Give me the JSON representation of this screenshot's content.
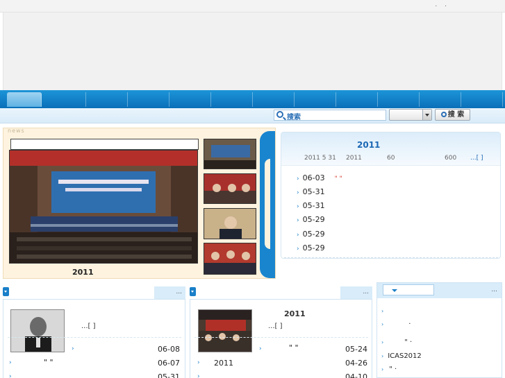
{
  "topbar": {
    "links": ". ."
  },
  "search": {
    "placeholder": "搜索",
    "button_label": "搜 索",
    "select_value": ""
  },
  "news_slider": {
    "tab_label": "news",
    "caption": "2011"
  },
  "right_panel": {
    "year": "2011",
    "subtitle": [
      "2011 5 31",
      "2011",
      "60",
      "600",
      "...[ ]"
    ],
    "items": [
      {
        "date": "06-03",
        "quote": "\"        \""
      },
      {
        "date": "05-31",
        "quote": ""
      },
      {
        "date": "05-31",
        "quote": ""
      },
      {
        "date": "05-29",
        "quote": ""
      },
      {
        "date": "05-29",
        "quote": ""
      },
      {
        "date": "05-29",
        "quote": ""
      }
    ]
  },
  "panel_left": {
    "more": "...",
    "bracket": "...[ ]",
    "rows": [
      {
        "text": "",
        "date": "06-08"
      },
      {
        "text": "\" \"",
        "date": "06-07"
      },
      {
        "text": "",
        "date": "05-31"
      }
    ]
  },
  "panel_mid": {
    "more": "...",
    "year": "2011",
    "bracket": "...[ ]",
    "rows": [
      {
        "text": "\"      \"",
        "date": "05-24"
      },
      {
        "text": "2011",
        "date": "04-26"
      },
      {
        "text": "",
        "date": "04-10"
      }
    ]
  },
  "side_panel": {
    "more": "...",
    "rows": [
      {
        "text": ""
      },
      {
        "text": "·"
      },
      {
        "text": "\" ·"
      },
      {
        "text": "ICAS2012"
      },
      {
        "text": "\" ·"
      }
    ]
  }
}
